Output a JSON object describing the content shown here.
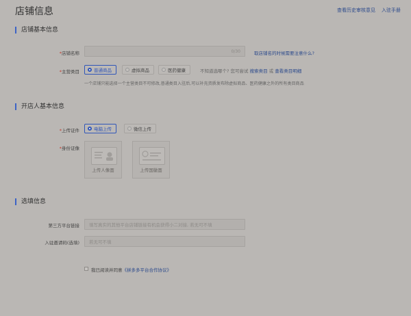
{
  "header": {
    "title": "店铺信息",
    "links": [
      "查看历史审核意见",
      "入驻手册"
    ]
  },
  "basic": {
    "section_title": "店铺基本信息",
    "shop_name": {
      "label": "店铺名称",
      "value": "",
      "counter": "0/30",
      "tip": "取店铺名的时候需要注意什么?"
    },
    "category": {
      "label": "主营类目",
      "options": [
        "普通商品",
        "虚拟商品",
        "医药健康"
      ],
      "selected": "普通商品",
      "help_prefix": "不知道选哪个? 您可尝试",
      "help_link_1": "搜索类目",
      "help_mid": "或",
      "help_link_2": "查看类目明细",
      "note": "一个店铺只能选择一个主营类目不可修改,普通类目入驻后,可以补充资质发布除虚拟商品、医药健康之外的所有类目商品"
    }
  },
  "owner": {
    "section_title": "开店人基本信息",
    "upload_method": {
      "label": "上传证件",
      "options": [
        "电脑上传",
        "微信上传"
      ],
      "selected": "电脑上传"
    },
    "id_card": {
      "label": "身份证像",
      "front": "上传人像面",
      "back": "上传国徽面"
    }
  },
  "optional": {
    "section_title": "选填信息",
    "third_party": {
      "label": "第三方平台链接",
      "placeholder": "填写真实的其他平台店铺链接有机会获得小二对接, 若无可不填"
    },
    "invite_code": {
      "label": "入驻邀请码(选填)",
      "placeholder": "若无可不填"
    }
  },
  "agreement": {
    "prefix": "我已阅读并同意",
    "link": "《拼多多平台合作协议》",
    "checked": false
  },
  "colors": {
    "accent": "#2f55b8",
    "link": "#2c4a8c",
    "required": "#c0392b",
    "background": "#bab7b4"
  }
}
